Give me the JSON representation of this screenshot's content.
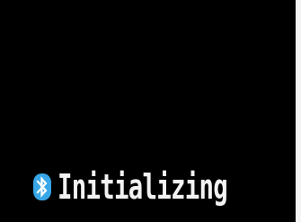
{
  "screen": {
    "status_icon": "bluetooth-icon",
    "status_text": "Initializing",
    "colors": {
      "background": "#000000",
      "text": "#f2f2f2",
      "icon": "#38a7e8"
    }
  }
}
